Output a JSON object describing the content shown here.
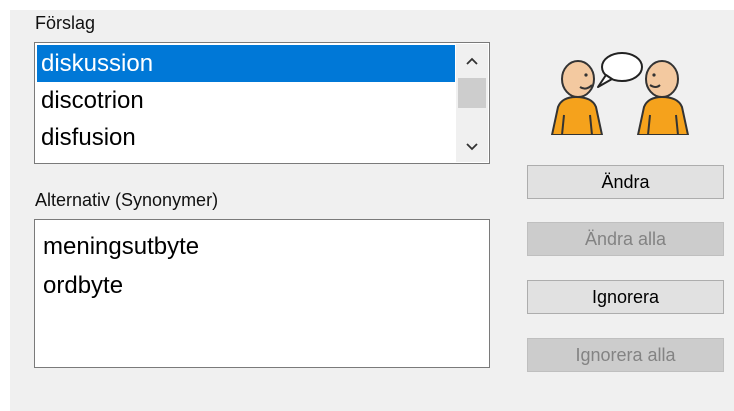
{
  "suggestions": {
    "label": "Förslag",
    "items": [
      "diskussion",
      "discotrion",
      "disfusion"
    ],
    "selected_index": 0
  },
  "alternatives": {
    "label": "Alternativ (Synonymer)",
    "items": [
      "meningsutbyte",
      "ordbyte"
    ]
  },
  "buttons": {
    "change": "Ändra",
    "change_all": "Ändra alla",
    "ignore": "Ignorera",
    "ignore_all": "Ignorera alla"
  },
  "colors": {
    "selection": "#0078d7",
    "figure_orange": "#f5a21c",
    "skin": "#f3c9a0"
  },
  "icons": [
    "chevron-up-icon",
    "chevron-down-icon",
    "two-people-talking-icon"
  ]
}
